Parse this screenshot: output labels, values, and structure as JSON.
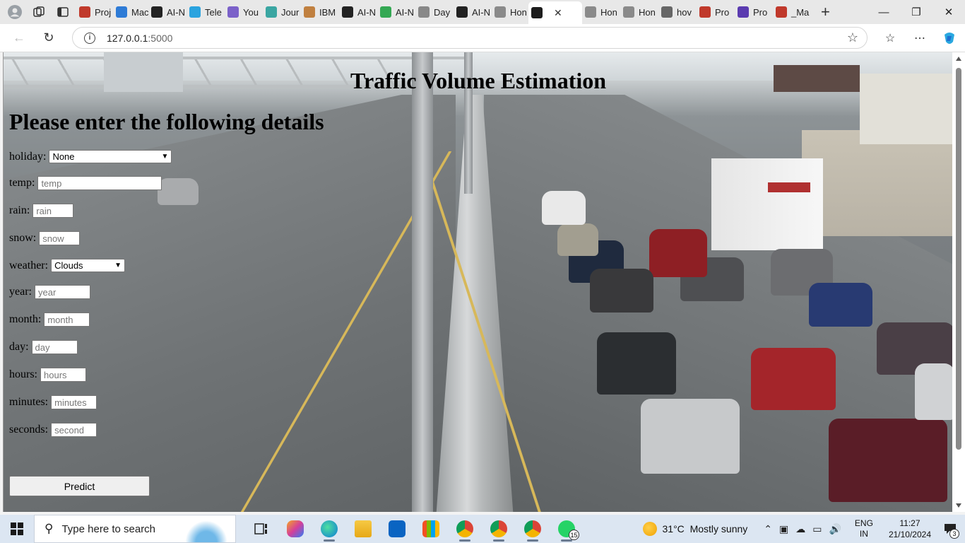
{
  "browser": {
    "tabs": [
      {
        "label": "Proj",
        "favicon": "pdf-icon",
        "color": "#c0392b"
      },
      {
        "label": "Mach",
        "favicon": "tab-icon",
        "color": "#2e7bd6"
      },
      {
        "label": "AI-N",
        "favicon": "github-icon",
        "color": "#222222"
      },
      {
        "label": "Tele",
        "favicon": "telegram-icon",
        "color": "#2aa3df"
      },
      {
        "label": "You",
        "favicon": "forms-icon",
        "color": "#7b61c9"
      },
      {
        "label": "Jour",
        "favicon": "x-icon",
        "color": "#3aa6a2"
      },
      {
        "label": "IBM",
        "favicon": "ibm-icon",
        "color": "#c08040"
      },
      {
        "label": "AI-N",
        "favicon": "github-icon",
        "color": "#222222"
      },
      {
        "label": "AI-N",
        "favicon": "drive-icon",
        "color": "#34a853"
      },
      {
        "label": "Day",
        "favicon": "doc-icon",
        "color": "#888888"
      },
      {
        "label": "AI-N",
        "favicon": "github-icon",
        "color": "#222222"
      },
      {
        "label": "Hon",
        "favicon": "page-icon",
        "color": "#8a8a8a"
      },
      {
        "label": "",
        "favicon": "terminal-icon",
        "color": "#1d1d1d",
        "active": true
      },
      {
        "label": "Hon",
        "favicon": "page-icon",
        "color": "#8a8a8a"
      },
      {
        "label": "Hon",
        "favicon": "page-icon",
        "color": "#8a8a8a"
      },
      {
        "label": "hov",
        "favicon": "search-icon",
        "color": "#666666"
      },
      {
        "label": "Pro",
        "favicon": "pdf-icon",
        "color": "#c0392b"
      },
      {
        "label": "Pro",
        "favicon": "forms-icon",
        "color": "#5b3bb0"
      },
      {
        "label": "_Ma",
        "favicon": "pdf-icon",
        "color": "#c0392b"
      }
    ],
    "url_host": "127.0.0.1",
    "url_port": ":5000"
  },
  "page": {
    "title": "Traffic Volume Estimation",
    "subtitle": "Please enter the following details",
    "fields": {
      "holiday": {
        "label": "holiday:",
        "value": "None"
      },
      "temp": {
        "label": "temp:",
        "placeholder": "temp"
      },
      "rain": {
        "label": "rain:",
        "placeholder": "rain"
      },
      "snow": {
        "label": "snow:",
        "placeholder": "snow"
      },
      "weather": {
        "label": "weather:",
        "value": "Clouds"
      },
      "year": {
        "label": "year:",
        "placeholder": "year"
      },
      "month": {
        "label": "month:",
        "placeholder": "month"
      },
      "day": {
        "label": "day:",
        "placeholder": "day"
      },
      "hours": {
        "label": "hours:",
        "placeholder": "hours"
      },
      "minutes": {
        "label": "minutes:",
        "placeholder": "minutes"
      },
      "seconds": {
        "label": "seconds:",
        "placeholder": "second"
      }
    },
    "predict_label": "Predict"
  },
  "taskbar": {
    "search_placeholder": "Type here to search",
    "whatsapp_badge": "15",
    "weather_temp": "31°C",
    "weather_text": "Mostly sunny",
    "lang_line1": "ENG",
    "lang_line2": "IN",
    "time": "11:27",
    "date": "21/10/2024",
    "notifications": "3"
  }
}
